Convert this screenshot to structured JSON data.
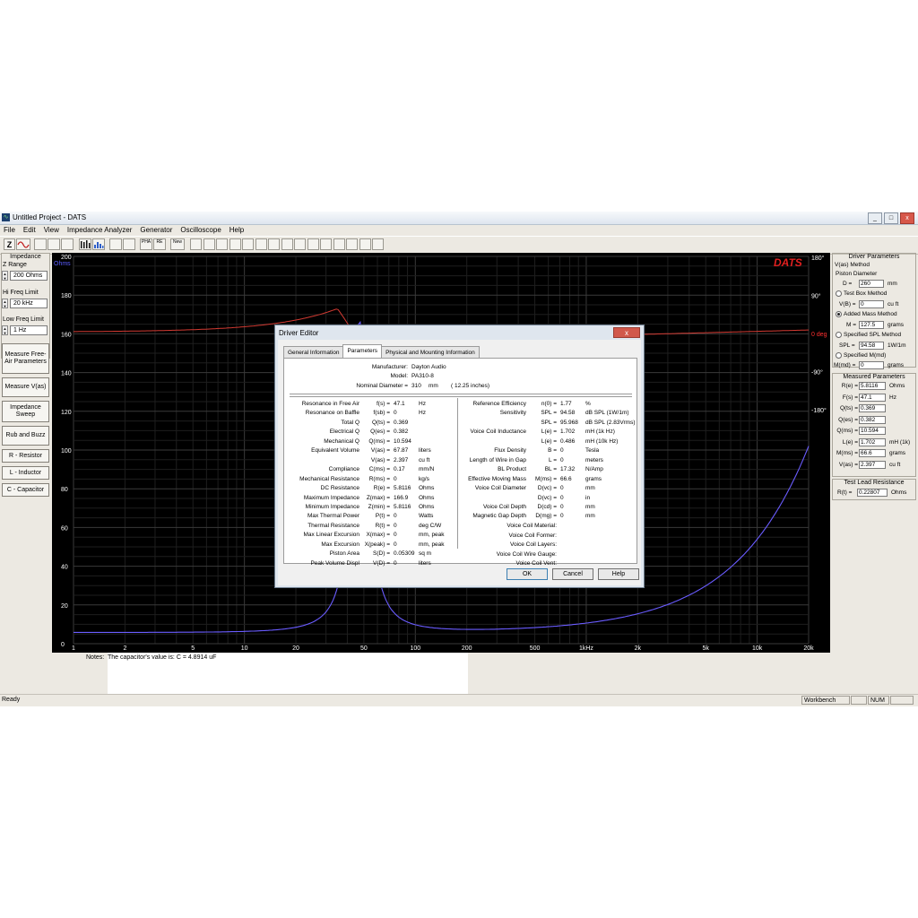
{
  "window": {
    "title": "Untitled Project - DATS",
    "app_icon": "∿",
    "btn_min": "_",
    "btn_max": "□",
    "btn_close": "x"
  },
  "menu": [
    "File",
    "Edit",
    "View",
    "Impedance Analyzer",
    "Generator",
    "Oscilloscope",
    "Help"
  ],
  "toolbar": {
    "z": "Z",
    "pha": "PHA",
    "re": "RE",
    "new": "New"
  },
  "left": {
    "impedance_label": "Impedance",
    "zrange_label": "Z Range",
    "zrange_value": "200 Ohms",
    "hifreq_label": "Hi Freq Limit",
    "hifreq_value": "20 kHz",
    "lowfreq_label": "Low Freq Limit",
    "lowfreq_value": "1 Hz",
    "btn_measure_free_air": "Measure Free-Air Parameters",
    "btn_measure_vas": "Measure V(as)",
    "btn_impedance_sweep": "Impedance Sweep",
    "btn_rub_buzz": "Rub and Buzz",
    "btn_resistor": "R - Resistor",
    "btn_inductor": "L - Inductor",
    "btn_capacitor": "C - Capacitor"
  },
  "graph": {
    "logo": "DATS",
    "y_unit": "Ohms",
    "y_ticks": [
      "200",
      "180",
      "160",
      "140",
      "120",
      "100",
      "80",
      "60",
      "40",
      "20",
      "0"
    ],
    "phase_ticks": [
      "180°",
      "90°",
      "0 deg",
      "-90°",
      "-180°"
    ],
    "x_ticks": [
      "1",
      "2",
      "5",
      "10",
      "20",
      "50",
      "100",
      "200",
      "500",
      "1kHz",
      "2k",
      "5k",
      "10k",
      "20k"
    ],
    "colors": {
      "impedance": "#6a5cff",
      "phase": "#d23a32",
      "grid": "#3a3a3a",
      "grid_minor": "#1e1e1e"
    }
  },
  "notes": {
    "label": "Notes:",
    "text": "The capacitor's value is:   C = 4.8914 uF"
  },
  "status": {
    "ready": "Ready",
    "workbench": "Workbench",
    "num": "NUM"
  },
  "right": {
    "title": "Driver Parameters",
    "vas_method": "V(as) Method",
    "piston_diameter": "Piston Diameter",
    "d_label": "D =",
    "d_value": "260",
    "d_unit": "mm",
    "test_box": "Test Box Method",
    "vb_label": "V(B) =",
    "vb_value": "0",
    "vb_unit": "cu ft",
    "added_mass": "Added Mass Method",
    "m_label": "M =",
    "m_value": "127.5",
    "m_unit": "grams",
    "specified_spl": "Specified SPL Method",
    "spl_label": "SPL =",
    "spl_value": "94.58",
    "spl_unit": "1W/1m",
    "specified_mmd": "Specified M(md)",
    "mmd_label": "M(md) =",
    "mmd_value": "0",
    "mmd_unit": "grams",
    "measured_title": "Measured Parameters",
    "measured": [
      {
        "label": "R(e) =",
        "value": "5.8116",
        "unit": "Ohms"
      },
      {
        "label": "F(s) =",
        "value": "47.1",
        "unit": "Hz"
      },
      {
        "label": "Q(ts) =",
        "value": "0.369",
        "unit": ""
      },
      {
        "label": "Q(es) =",
        "value": "0.382",
        "unit": ""
      },
      {
        "label": "Q(ms) =",
        "value": "10.594",
        "unit": ""
      },
      {
        "label": "L(e) =",
        "value": "1.702",
        "unit": "mH (1k)"
      },
      {
        "label": "M(ms) =",
        "value": "66.6",
        "unit": "grams"
      },
      {
        "label": "V(as) =",
        "value": "2.397",
        "unit": "cu ft"
      }
    ],
    "test_lead_title": "Test Lead Resistance",
    "rt_label": "R(t) =",
    "rt_value": "0.22807",
    "rt_unit": "Ohms"
  },
  "dialog": {
    "title": "Driver Editor",
    "close": "x",
    "tabs": [
      "General Information",
      "Parameters",
      "Physical and Mounting Information"
    ],
    "manufacturer_label": "Manufacturer:",
    "manufacturer": "Dayton Audio",
    "model_label": "Model:",
    "model": "PA310-8",
    "nominal_label": "Nominal Diameter =",
    "nominal_value": "310",
    "nominal_unit": "mm",
    "nominal_inches": "( 12.25  inches)",
    "left_params": [
      {
        "name": "Resonance in Free Air",
        "sym": "f(s) =",
        "val": "47.1",
        "unit": "Hz"
      },
      {
        "name": "Resonance on Baffle",
        "sym": "f(sb) =",
        "val": "0",
        "unit": "Hz"
      },
      {
        "name": "Total Q",
        "sym": "Q(ts) =",
        "val": "0.369",
        "unit": ""
      },
      {
        "name": "Electrical Q",
        "sym": "Q(es) =",
        "val": "0.382",
        "unit": ""
      },
      {
        "name": "Mechanical Q",
        "sym": "Q(ms) =",
        "val": "10.594",
        "unit": ""
      },
      {
        "name": "Equivalent Volume",
        "sym": "V(as) =",
        "val": "67.87",
        "unit": "liters"
      },
      {
        "name": "",
        "sym": "V(as) =",
        "val": "2.397",
        "unit": "cu ft"
      },
      {
        "name": "Compliance",
        "sym": "C(ms) =",
        "val": "0.17",
        "unit": "mm/N"
      },
      {
        "name": "Mechanical Resistance",
        "sym": "R(ms) =",
        "val": "0",
        "unit": "kg/s"
      },
      {
        "name": "DC Resistance",
        "sym": "R(e) =",
        "val": "5.8116",
        "unit": "Ohms"
      },
      {
        "name": "Maximum Impedance",
        "sym": "Z(max) =",
        "val": "166.9",
        "unit": "Ohms"
      },
      {
        "name": "Minimum Impedance",
        "sym": "Z(min) =",
        "val": "5.8116",
        "unit": "Ohms"
      },
      {
        "name": "Max Thermal Power",
        "sym": "P(t) =",
        "val": "0",
        "unit": "Watts"
      },
      {
        "name": "Thermal Resistance",
        "sym": "R(t) =",
        "val": "0",
        "unit": "deg C/W"
      },
      {
        "name": "Max Linear Excursion",
        "sym": "X(max) =",
        "val": "0",
        "unit": "mm, peak"
      },
      {
        "name": "Max Excursion",
        "sym": "X(peak) =",
        "val": "0",
        "unit": "mm, peak"
      },
      {
        "name": "Piston Area",
        "sym": "S(D) =",
        "val": "0.05309",
        "unit": "sq m"
      },
      {
        "name": "Peak Volume Displ",
        "sym": "V(D) =",
        "val": "0",
        "unit": "liters"
      }
    ],
    "right_params": [
      {
        "name": "Reference Efficiency",
        "sym": "n(0) =",
        "val": "1.77",
        "unit": "%"
      },
      {
        "name": "Sensitivity",
        "sym": "SPL =",
        "val": "94.58",
        "unit": "dB SPL (1W/1m)"
      },
      {
        "name": "",
        "sym": "SPL =",
        "val": "95.968",
        "unit": "dB SPL (2.83Vrms)"
      },
      {
        "name": "Voice Coil Inductance",
        "sym": "L(e) =",
        "val": "1.702",
        "unit": "mH (1k Hz)"
      },
      {
        "name": "",
        "sym": "L(e) =",
        "val": "0.486",
        "unit": "mH (10k Hz)"
      },
      {
        "name": "Flux Density",
        "sym": "B =",
        "val": "0",
        "unit": "Tesla"
      },
      {
        "name": "Length of Wire in Gap",
        "sym": "L =",
        "val": "0",
        "unit": "meters"
      },
      {
        "name": "BL Product",
        "sym": "BL =",
        "val": "17.32",
        "unit": "N/Amp"
      },
      {
        "name": "Effective Moving Mass",
        "sym": "M(ms) =",
        "val": "66.6",
        "unit": "grams"
      },
      {
        "name": "Voice Coil Diameter",
        "sym": "D(vc) =",
        "val": "0",
        "unit": "mm"
      },
      {
        "name": "",
        "sym": "D(vc) =",
        "val": "0",
        "unit": "in"
      },
      {
        "name": "Voice Coil Depth",
        "sym": "D(cd) =",
        "val": "0",
        "unit": "mm"
      },
      {
        "name": "Magnetic Gap Depth",
        "sym": "D(mg) =",
        "val": "0",
        "unit": "mm"
      }
    ],
    "text_fields": [
      "Voice Coil Material:",
      "Voice Coil Former:",
      "Voice Coil Layers:",
      "Voice Coil Wire Gauge:",
      "Voice Coil Vent:"
    ],
    "btn_ok": "OK",
    "btn_cancel": "Cancel",
    "btn_help": "Help"
  }
}
